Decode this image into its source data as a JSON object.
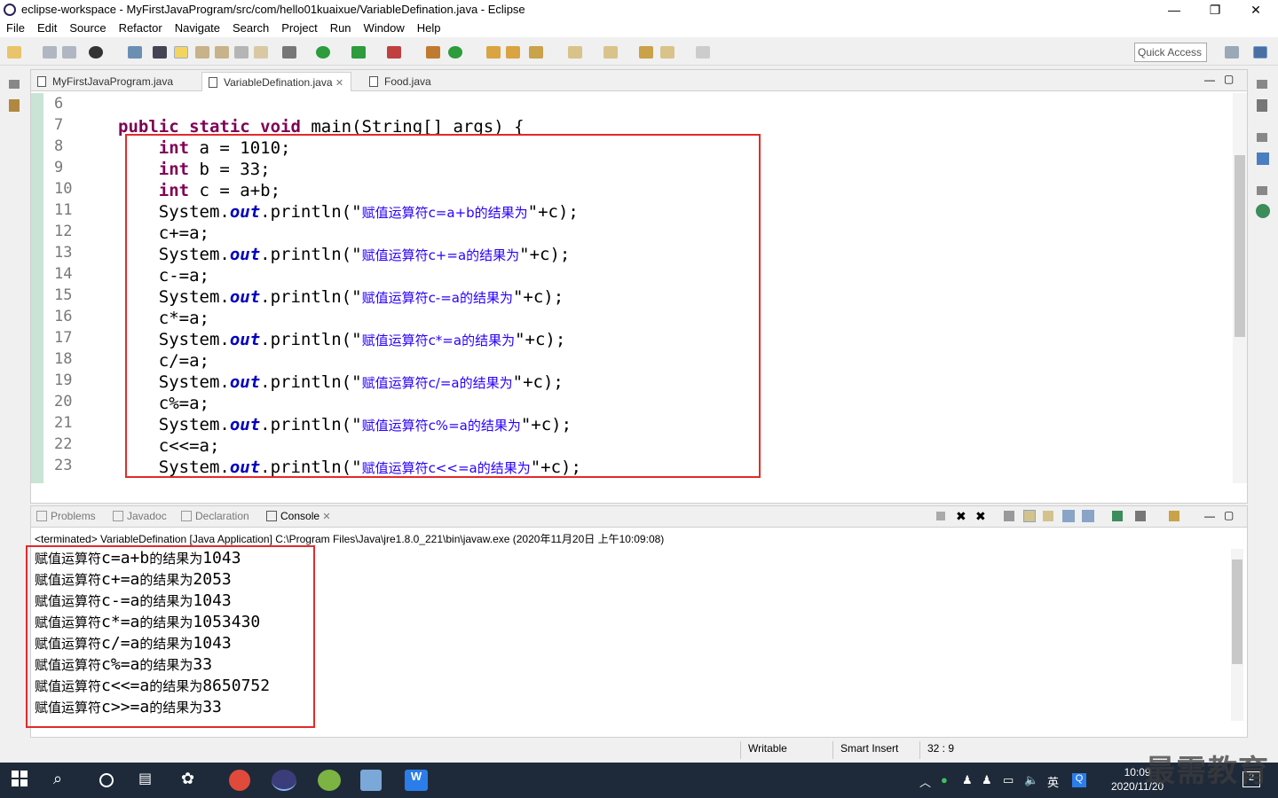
{
  "window": {
    "title": "eclipse-workspace - MyFirstJavaProgram/src/com/hello01kuaixue/VariableDefination.java - Eclipse"
  },
  "menu": [
    "File",
    "Edit",
    "Source",
    "Refactor",
    "Navigate",
    "Search",
    "Project",
    "Run",
    "Window",
    "Help"
  ],
  "toolbar": {
    "quick_access": "Quick Access"
  },
  "editor": {
    "tabs": [
      {
        "label": "MyFirstJavaProgram.java"
      },
      {
        "label": "VariableDefination.java",
        "close": "✕"
      },
      {
        "label": "Food.java"
      }
    ],
    "line_numbers": [
      "6",
      "7",
      "8",
      "9",
      "10",
      "11",
      "12",
      "13",
      "14",
      "15",
      "16",
      "17",
      "18",
      "19",
      "20",
      "21",
      "22",
      "23"
    ],
    "method_signature": {
      "keywords": "public static void",
      "rest": " main(String[] args) {"
    },
    "decls": [
      {
        "kw": "int",
        "rest": " a = 1010;"
      },
      {
        "kw": "int",
        "rest": " b = 33;"
      },
      {
        "kw": "int",
        "rest": " c = a+b;"
      }
    ],
    "lines": [
      {
        "stmt": "System.",
        "field": "out",
        "call": ".println(\"",
        "msg": "赋值运算符c=a+b的结果为",
        "tail": "\"+c);"
      },
      {
        "op": "c+=a;"
      },
      {
        "stmt": "System.",
        "field": "out",
        "call": ".println(\"",
        "msg": "赋值运算符c+=a的结果为",
        "tail": "\"+c);"
      },
      {
        "op": "c-=a;"
      },
      {
        "stmt": "System.",
        "field": "out",
        "call": ".println(\"",
        "msg": "赋值运算符c-=a的结果为",
        "tail": "\"+c);"
      },
      {
        "op": "c*=a;"
      },
      {
        "stmt": "System.",
        "field": "out",
        "call": ".println(\"",
        "msg": "赋值运算符c*=a的结果为",
        "tail": "\"+c);"
      },
      {
        "op": "c/=a;"
      },
      {
        "stmt": "System.",
        "field": "out",
        "call": ".println(\"",
        "msg": "赋值运算符c/=a的结果为",
        "tail": "\"+c);"
      },
      {
        "op": "c%=a;"
      },
      {
        "stmt": "System.",
        "field": "out",
        "call": ".println(\"",
        "msg": "赋值运算符c%=a的结果为",
        "tail": "\"+c);"
      },
      {
        "op": "c<<=a;"
      },
      {
        "stmt": "System.",
        "field": "out",
        "call": ".println(\"",
        "msg": "赋值运算符c<<=a的结果为",
        "tail": "\"+c);"
      }
    ]
  },
  "console": {
    "tabs": [
      "Problems",
      "Javadoc",
      "Declaration",
      "Console"
    ],
    "description": "<terminated> VariableDefination [Java Application] C:\\Program Files\\Java\\jre1.8.0_221\\bin\\javaw.exe (2020年11月20日 上午10:09:08)",
    "output": [
      {
        "label": "赋值运算符",
        "expr": "c=a+b",
        "mid": "的结果为",
        "value": "1043"
      },
      {
        "label": "赋值运算符",
        "expr": "c+=a",
        "mid": "的结果为",
        "value": "2053"
      },
      {
        "label": "赋值运算符",
        "expr": "c-=a",
        "mid": "的结果为",
        "value": "1043"
      },
      {
        "label": "赋值运算符",
        "expr": "c*=a",
        "mid": "的结果为",
        "value": "1053430"
      },
      {
        "label": "赋值运算符",
        "expr": "c/=a",
        "mid": "的结果为",
        "value": "1043"
      },
      {
        "label": "赋值运算符",
        "expr": "c%=a",
        "mid": "的结果为",
        "value": "33"
      },
      {
        "label": "赋值运算符",
        "expr": "c<<=a",
        "mid": "的结果为",
        "value": "8650752"
      },
      {
        "label": "赋值运算符",
        "expr": "c>>=a",
        "mid": "的结果为",
        "value": "33"
      }
    ]
  },
  "status": {
    "writable": "Writable",
    "insert_mode": "Smart Insert",
    "position": "32 : 9"
  },
  "taskbar": {
    "time": "10:09",
    "date": "2020/11/20",
    "ime": "英",
    "notifications": "2"
  },
  "watermark": "最需教育",
  "colors": {
    "keyword": "#7f0055",
    "string": "#2a00ff",
    "field": "#0000c0",
    "highlight_box": "#e12b2b"
  }
}
